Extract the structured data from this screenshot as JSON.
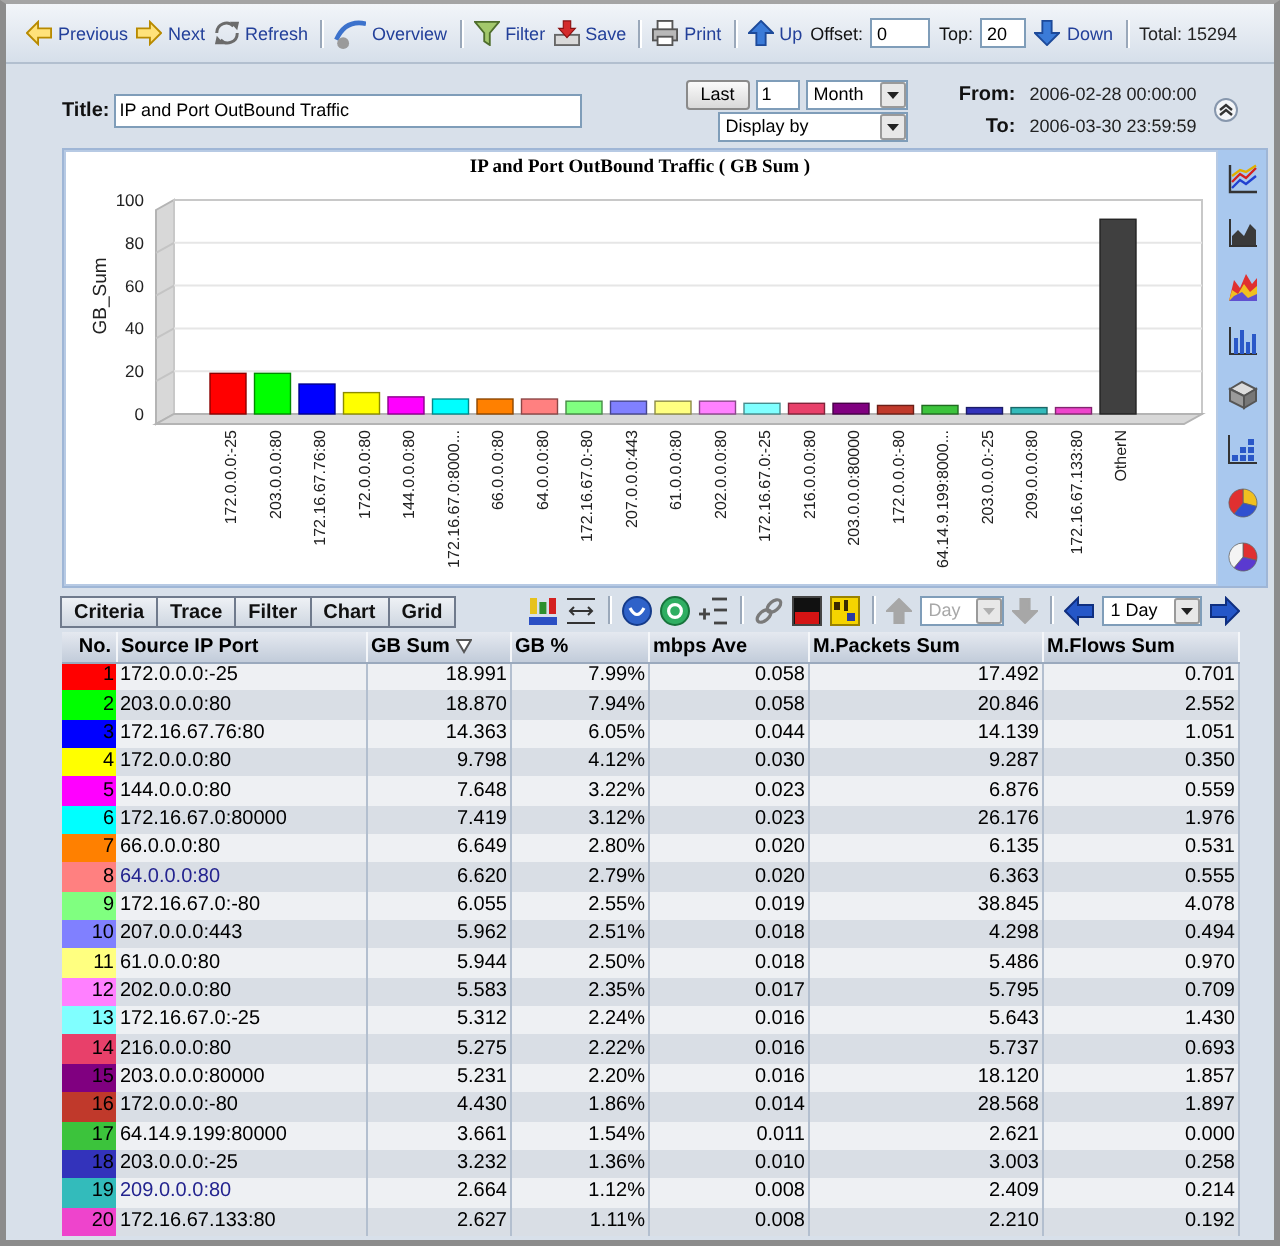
{
  "toolbar": {
    "previous": "Previous",
    "next": "Next",
    "refresh": "Refresh",
    "overview": "Overview",
    "filter": "Filter",
    "save": "Save",
    "print": "Print",
    "up": "Up",
    "offset": {
      "label": "Offset:",
      "value": "0"
    },
    "top": {
      "label": "Top:",
      "value": "20"
    },
    "down": "Down",
    "total": "Total: 15294"
  },
  "report_form": {
    "title_label": "Title:",
    "title_value": "IP and Port OutBound Traffic",
    "last_button": "Last",
    "count": "1",
    "period": "Month",
    "display_by": "Display by",
    "from_label": "From:",
    "from_value": "2006-02-28 00:00:00",
    "to_label": "To:",
    "to_value": "2006-03-30 23:59:59"
  },
  "chart": {
    "chart_data": {
      "type": "bar",
      "title": "IP and Port OutBound Traffic ( GB Sum )",
      "ylabel": "GB_Sum",
      "categories": [
        "172.0.0.0:-25",
        "203.0.0.0:80",
        "172.16.67.76:80",
        "172.0.0.0:80",
        "144.0.0.0:80",
        "172.16.67.0:8000...",
        "66.0.0.0:80",
        "64.0.0.0:80",
        "172.16.67.0:-80",
        "207.0.0.0:443",
        "61.0.0.0:80",
        "202.0.0.0:80",
        "172.16.67.0:-25",
        "216.0.0.0:80",
        "203.0.0.0:80000",
        "172.0.0.0:-80",
        "64.14.9.199:8000...",
        "203.0.0.0:-25",
        "209.0.0.0:80",
        "172.16.67.133:80",
        "OtherN"
      ],
      "stacked": true,
      "grid": true,
      "ylim": [
        0,
        100
      ],
      "yticks": [
        0,
        20,
        40,
        60,
        80,
        100
      ],
      "series": [
        {
          "color": "#ff0000",
          "values": [
            19,
            null,
            null,
            null,
            null,
            null,
            null,
            null,
            null,
            null,
            null,
            null,
            null,
            null,
            null,
            null,
            null,
            null,
            null,
            null,
            null
          ]
        },
        {
          "color": "#00ff00",
          "values": [
            null,
            19,
            null,
            null,
            null,
            null,
            null,
            null,
            null,
            null,
            null,
            null,
            null,
            null,
            null,
            null,
            null,
            null,
            null,
            null,
            null
          ]
        },
        {
          "color": "#0000ff",
          "values": [
            null,
            null,
            14,
            null,
            null,
            null,
            null,
            null,
            null,
            null,
            null,
            null,
            null,
            null,
            null,
            null,
            null,
            null,
            null,
            null,
            null
          ]
        },
        {
          "color": "#ffff00",
          "values": [
            null,
            null,
            null,
            10,
            null,
            null,
            null,
            null,
            null,
            null,
            null,
            null,
            null,
            null,
            null,
            null,
            null,
            null,
            null,
            null,
            null
          ]
        },
        {
          "color": "#ff00ff",
          "values": [
            null,
            null,
            null,
            null,
            8,
            null,
            null,
            null,
            null,
            null,
            null,
            null,
            null,
            null,
            null,
            null,
            null,
            null,
            null,
            null,
            null
          ]
        },
        {
          "color": "#00ffff",
          "values": [
            null,
            null,
            null,
            null,
            null,
            7,
            null,
            null,
            null,
            null,
            null,
            null,
            null,
            null,
            null,
            null,
            null,
            null,
            null,
            null,
            null
          ]
        },
        {
          "color": "#ff8000",
          "values": [
            null,
            null,
            null,
            null,
            null,
            null,
            7,
            null,
            null,
            null,
            null,
            null,
            null,
            null,
            null,
            null,
            null,
            null,
            null,
            null,
            null
          ]
        },
        {
          "color": "#ff8080",
          "values": [
            null,
            null,
            null,
            null,
            null,
            null,
            null,
            7,
            null,
            null,
            null,
            null,
            null,
            null,
            null,
            null,
            null,
            null,
            null,
            null,
            null
          ]
        },
        {
          "color": "#80ff80",
          "values": [
            null,
            null,
            null,
            null,
            null,
            null,
            null,
            null,
            6,
            null,
            null,
            null,
            null,
            null,
            null,
            null,
            null,
            null,
            null,
            null,
            null
          ]
        },
        {
          "color": "#8080ff",
          "values": [
            null,
            null,
            null,
            null,
            null,
            null,
            null,
            null,
            null,
            6,
            null,
            null,
            null,
            null,
            null,
            null,
            null,
            null,
            null,
            null,
            null
          ]
        },
        {
          "color": "#ffff80",
          "values": [
            null,
            null,
            null,
            null,
            null,
            null,
            null,
            null,
            null,
            null,
            6,
            null,
            null,
            null,
            null,
            null,
            null,
            null,
            null,
            null,
            null
          ]
        },
        {
          "color": "#ff80ff",
          "values": [
            null,
            null,
            null,
            null,
            null,
            null,
            null,
            null,
            null,
            null,
            null,
            6,
            null,
            null,
            null,
            null,
            null,
            null,
            null,
            null,
            null
          ]
        },
        {
          "color": "#80ffff",
          "values": [
            null,
            null,
            null,
            null,
            null,
            null,
            null,
            null,
            null,
            null,
            null,
            null,
            5,
            null,
            null,
            null,
            null,
            null,
            null,
            null,
            null
          ]
        },
        {
          "color": "#e8406a",
          "values": [
            null,
            null,
            null,
            null,
            null,
            null,
            null,
            null,
            null,
            null,
            null,
            null,
            null,
            5,
            null,
            null,
            null,
            null,
            null,
            null,
            null
          ]
        },
        {
          "color": "#800080",
          "values": [
            null,
            null,
            null,
            null,
            null,
            null,
            null,
            null,
            null,
            null,
            null,
            null,
            null,
            null,
            5,
            null,
            null,
            null,
            null,
            null,
            null
          ]
        },
        {
          "color": "#c0392b",
          "values": [
            null,
            null,
            null,
            null,
            null,
            null,
            null,
            null,
            null,
            null,
            null,
            null,
            null,
            null,
            null,
            4,
            null,
            null,
            null,
            null,
            null
          ]
        },
        {
          "color": "#3cc33c",
          "values": [
            null,
            null,
            null,
            null,
            null,
            null,
            null,
            null,
            null,
            null,
            null,
            null,
            null,
            null,
            null,
            null,
            4,
            null,
            null,
            null,
            null
          ]
        },
        {
          "color": "#3333bb",
          "values": [
            null,
            null,
            null,
            null,
            null,
            null,
            null,
            null,
            null,
            null,
            null,
            null,
            null,
            null,
            null,
            null,
            null,
            3,
            null,
            null,
            null
          ]
        },
        {
          "color": "#33bbbb",
          "values": [
            null,
            null,
            null,
            null,
            null,
            null,
            null,
            null,
            null,
            null,
            null,
            null,
            null,
            null,
            null,
            null,
            null,
            null,
            3,
            null,
            null
          ]
        },
        {
          "color": "#ee44cc",
          "values": [
            null,
            null,
            null,
            null,
            null,
            null,
            null,
            null,
            null,
            null,
            null,
            null,
            null,
            null,
            null,
            null,
            null,
            null,
            null,
            3,
            null
          ]
        },
        {
          "color": "#404040",
          "values": [
            null,
            null,
            null,
            null,
            null,
            null,
            null,
            null,
            null,
            null,
            null,
            null,
            null,
            null,
            null,
            null,
            null,
            null,
            null,
            null,
            91
          ]
        }
      ]
    }
  },
  "grid_toolbar": {
    "tabs": [
      "Criteria",
      "Trace",
      "Filter",
      "Chart",
      "Grid"
    ],
    "step_unit": {
      "value": "Day",
      "disabled": true
    },
    "range": "1 Day"
  },
  "table": {
    "columns": [
      {
        "label": "No.",
        "sorted": false
      },
      {
        "label": "Source IP Port",
        "sorted": false
      },
      {
        "label": "GB Sum",
        "sorted": true
      },
      {
        "label": "GB %",
        "sorted": false
      },
      {
        "label": "mbps Ave",
        "sorted": false
      },
      {
        "label": "M.Packets Sum",
        "sorted": false
      },
      {
        "label": "M.Flows Sum",
        "sorted": false
      }
    ],
    "rows": [
      {
        "no": "1",
        "color": "#ff0000",
        "source": "172.0.0.0:-25",
        "highlighted": false,
        "gb_sum": "18.991",
        "gb_pct": "7.99%",
        "mbps": "0.058",
        "packets": "17.492",
        "flows": "0.701"
      },
      {
        "no": "2",
        "color": "#00ff00",
        "source": "203.0.0.0:80",
        "highlighted": false,
        "gb_sum": "18.870",
        "gb_pct": "7.94%",
        "mbps": "0.058",
        "packets": "20.846",
        "flows": "2.552"
      },
      {
        "no": "3",
        "color": "#0000ff",
        "source": "172.16.67.76:80",
        "highlighted": false,
        "gb_sum": "14.363",
        "gb_pct": "6.05%",
        "mbps": "0.044",
        "packets": "14.139",
        "flows": "1.051"
      },
      {
        "no": "4",
        "color": "#ffff00",
        "source": "172.0.0.0:80",
        "highlighted": false,
        "gb_sum": "9.798",
        "gb_pct": "4.12%",
        "mbps": "0.030",
        "packets": "9.287",
        "flows": "0.350"
      },
      {
        "no": "5",
        "color": "#ff00ff",
        "source": "144.0.0.0:80",
        "highlighted": false,
        "gb_sum": "7.648",
        "gb_pct": "3.22%",
        "mbps": "0.023",
        "packets": "6.876",
        "flows": "0.559"
      },
      {
        "no": "6",
        "color": "#00ffff",
        "source": "172.16.67.0:80000",
        "highlighted": false,
        "gb_sum": "7.419",
        "gb_pct": "3.12%",
        "mbps": "0.023",
        "packets": "26.176",
        "flows": "1.976"
      },
      {
        "no": "7",
        "color": "#ff8000",
        "source": "66.0.0.0:80",
        "highlighted": false,
        "gb_sum": "6.649",
        "gb_pct": "2.80%",
        "mbps": "0.020",
        "packets": "6.135",
        "flows": "0.531"
      },
      {
        "no": "8",
        "color": "#ff8080",
        "source": "64.0.0.0:80",
        "highlighted": true,
        "gb_sum": "6.620",
        "gb_pct": "2.79%",
        "mbps": "0.020",
        "packets": "6.363",
        "flows": "0.555"
      },
      {
        "no": "9",
        "color": "#80ff80",
        "source": "172.16.67.0:-80",
        "highlighted": false,
        "gb_sum": "6.055",
        "gb_pct": "2.55%",
        "mbps": "0.019",
        "packets": "38.845",
        "flows": "4.078"
      },
      {
        "no": "10",
        "color": "#8080ff",
        "source": "207.0.0.0:443",
        "highlighted": false,
        "gb_sum": "5.962",
        "gb_pct": "2.51%",
        "mbps": "0.018",
        "packets": "4.298",
        "flows": "0.494"
      },
      {
        "no": "11",
        "color": "#ffff80",
        "source": "61.0.0.0:80",
        "highlighted": false,
        "gb_sum": "5.944",
        "gb_pct": "2.50%",
        "mbps": "0.018",
        "packets": "5.486",
        "flows": "0.970"
      },
      {
        "no": "12",
        "color": "#ff80ff",
        "source": "202.0.0.0:80",
        "highlighted": false,
        "gb_sum": "5.583",
        "gb_pct": "2.35%",
        "mbps": "0.017",
        "packets": "5.795",
        "flows": "0.709"
      },
      {
        "no": "13",
        "color": "#80ffff",
        "source": "172.16.67.0:-25",
        "highlighted": false,
        "gb_sum": "5.312",
        "gb_pct": "2.24%",
        "mbps": "0.016",
        "packets": "5.643",
        "flows": "1.430"
      },
      {
        "no": "14",
        "color": "#e8406a",
        "source": "216.0.0.0:80",
        "highlighted": false,
        "gb_sum": "5.275",
        "gb_pct": "2.22%",
        "mbps": "0.016",
        "packets": "5.737",
        "flows": "0.693"
      },
      {
        "no": "15",
        "color": "#800080",
        "source": "203.0.0.0:80000",
        "highlighted": false,
        "gb_sum": "5.231",
        "gb_pct": "2.20%",
        "mbps": "0.016",
        "packets": "18.120",
        "flows": "1.857"
      },
      {
        "no": "16",
        "color": "#c0392b",
        "source": "172.0.0.0:-80",
        "highlighted": false,
        "gb_sum": "4.430",
        "gb_pct": "1.86%",
        "mbps": "0.014",
        "packets": "28.568",
        "flows": "1.897"
      },
      {
        "no": "17",
        "color": "#3cc33c",
        "source": "64.14.9.199:80000",
        "highlighted": false,
        "gb_sum": "3.661",
        "gb_pct": "1.54%",
        "mbps": "0.011",
        "packets": "2.621",
        "flows": "0.000"
      },
      {
        "no": "18",
        "color": "#3333bb",
        "source": "203.0.0.0:-25",
        "highlighted": false,
        "gb_sum": "3.232",
        "gb_pct": "1.36%",
        "mbps": "0.010",
        "packets": "3.003",
        "flows": "0.258"
      },
      {
        "no": "19",
        "color": "#33bbbb",
        "source": "209.0.0.0:80",
        "highlighted": true,
        "gb_sum": "2.664",
        "gb_pct": "1.12%",
        "mbps": "0.008",
        "packets": "2.409",
        "flows": "0.214"
      },
      {
        "no": "20",
        "color": "#ee44cc",
        "source": "172.16.67.133:80",
        "highlighted": false,
        "gb_sum": "2.627",
        "gb_pct": "1.11%",
        "mbps": "0.008",
        "packets": "2.210",
        "flows": "0.192"
      }
    ]
  }
}
